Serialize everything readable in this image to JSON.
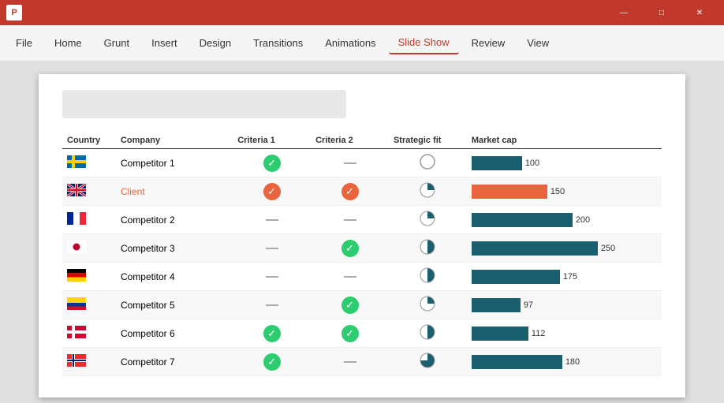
{
  "titleBar": {
    "appIcon": "P",
    "minimize": "—",
    "maximize": "□",
    "close": "✕"
  },
  "ribbon": {
    "tabs": [
      {
        "label": "File",
        "active": false
      },
      {
        "label": "Home",
        "active": false
      },
      {
        "label": "Grunt",
        "active": false
      },
      {
        "label": "Insert",
        "active": false
      },
      {
        "label": "Design",
        "active": false
      },
      {
        "label": "Transitions",
        "active": false
      },
      {
        "label": "Animations",
        "active": false
      },
      {
        "label": "Slide Show",
        "active": true
      },
      {
        "label": "Review",
        "active": false
      },
      {
        "label": "View",
        "active": false
      }
    ]
  },
  "table": {
    "headers": [
      "Country",
      "Company",
      "Criteria 1",
      "Criteria 2",
      "Strategic fit",
      "Market cap"
    ],
    "rows": [
      {
        "flag": "se",
        "company": "Competitor 1",
        "isClient": false,
        "criteria1": "check",
        "criteria2": "dash",
        "strategic": "empty",
        "marketCap": 100,
        "maxBar": 250,
        "barType": "dark"
      },
      {
        "flag": "gb",
        "company": "Client",
        "isClient": true,
        "criteria1": "check-orange",
        "criteria2": "check-orange",
        "strategic": "pie-25",
        "marketCap": 150,
        "maxBar": 250,
        "barType": "orange"
      },
      {
        "flag": "fr",
        "company": "Competitor 2",
        "isClient": false,
        "criteria1": "dash",
        "criteria2": "dash",
        "strategic": "pie-25",
        "marketCap": 200,
        "maxBar": 250,
        "barType": "dark"
      },
      {
        "flag": "jp",
        "company": "Competitor 3",
        "isClient": false,
        "criteria1": "dash",
        "criteria2": "check",
        "strategic": "pie-50",
        "marketCap": 250,
        "maxBar": 250,
        "barType": "dark"
      },
      {
        "flag": "de",
        "company": "Competitor 4",
        "isClient": false,
        "criteria1": "dash",
        "criteria2": "dash",
        "strategic": "pie-50",
        "marketCap": 175,
        "maxBar": 250,
        "barType": "dark"
      },
      {
        "flag": "co",
        "company": "Competitor 5",
        "isClient": false,
        "criteria1": "dash",
        "criteria2": "check",
        "strategic": "pie-25",
        "marketCap": 97,
        "maxBar": 250,
        "barType": "dark"
      },
      {
        "flag": "dk",
        "company": "Competitor 6",
        "isClient": false,
        "criteria1": "check",
        "criteria2": "check",
        "strategic": "pie-50",
        "marketCap": 112,
        "maxBar": 250,
        "barType": "dark"
      },
      {
        "flag": "no",
        "company": "Competitor 7",
        "isClient": false,
        "criteria1": "check",
        "criteria2": "dash",
        "strategic": "pie-75",
        "marketCap": 180,
        "maxBar": 250,
        "barType": "dark"
      }
    ]
  }
}
